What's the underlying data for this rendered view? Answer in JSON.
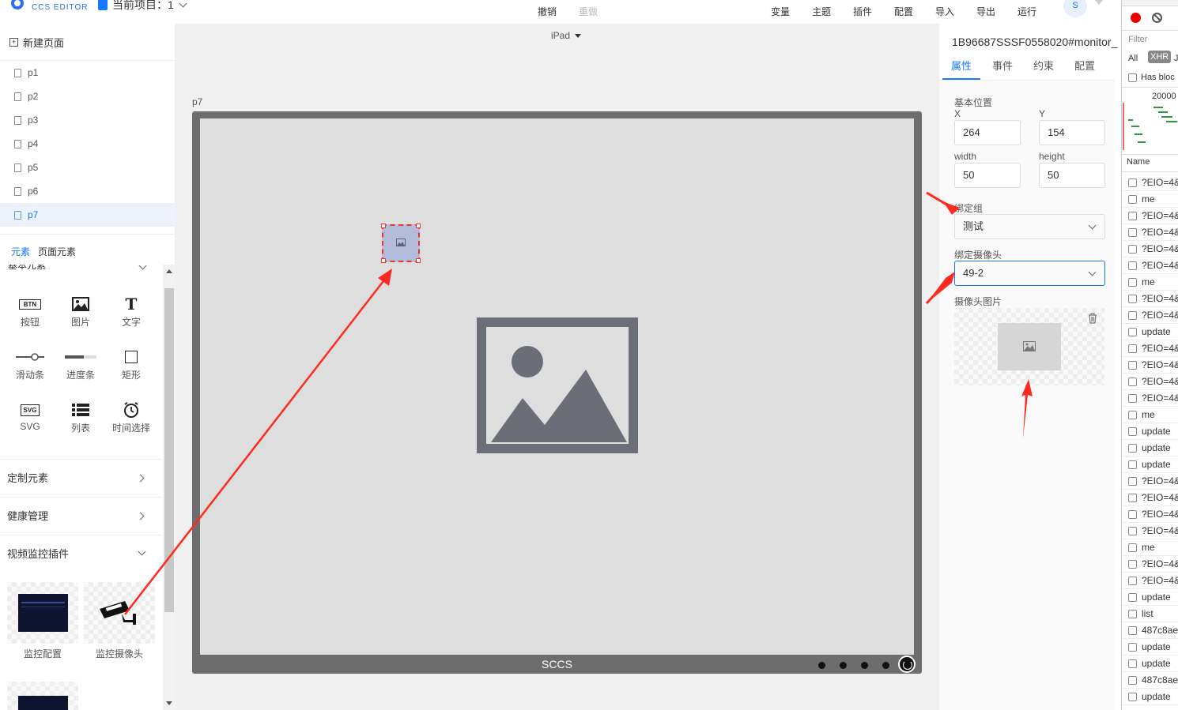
{
  "topbar": {
    "logo_text": "CCS EDITOR",
    "project_label": "当前项目：1",
    "undo": "撤销",
    "redo": "重做",
    "buttons": [
      "变量",
      "主题",
      "插件",
      "配置",
      "导入",
      "导出",
      "运行"
    ],
    "avatar": "S"
  },
  "sidebar": {
    "new_page": "新建页面",
    "pages": [
      "p1",
      "p2",
      "p3",
      "p4",
      "p5",
      "p6",
      "p7"
    ],
    "active_page": "p7",
    "tabs": [
      "元素",
      "页面元素"
    ],
    "basic_title": "基本元素",
    "tools": [
      {
        "label": "按钮",
        "icon": "btn-icon"
      },
      {
        "label": "图片",
        "icon": "image-icon"
      },
      {
        "label": "文字",
        "icon": "text-icon"
      },
      {
        "label": "滑动条",
        "icon": "slider-icon"
      },
      {
        "label": "进度条",
        "icon": "progress-icon"
      },
      {
        "label": "矩形",
        "icon": "rect-icon"
      },
      {
        "label": "SVG",
        "icon": "svg-icon"
      },
      {
        "label": "列表",
        "icon": "list-icon"
      },
      {
        "label": "时间选择",
        "icon": "clock-icon"
      }
    ],
    "sections": [
      "定制元素",
      "健康管理",
      "视频监控插件"
    ],
    "plugins": [
      "监控配置",
      "监控摄像头"
    ]
  },
  "canvas": {
    "device": "iPad",
    "page_label": "p7",
    "footer": "SCCS"
  },
  "props": {
    "element_id": "1B96687SSSF0558020#monitor_",
    "tabs": [
      "属性",
      "事件",
      "约束",
      "配置"
    ],
    "section_position": "基本位置",
    "x_label": "X",
    "x": "264",
    "y_label": "Y",
    "y": "154",
    "width_label": "width",
    "width": "50",
    "height_label": "height",
    "height": "50",
    "group_label": "绑定组",
    "group": "测试",
    "camera_label": "绑定摄像头",
    "camera": "49-2",
    "image_label": "摄像头图片"
  },
  "devtools": {
    "filter": "Filter",
    "filter_all": "All",
    "filter_xhr": "XHR",
    "filter_js": "J",
    "has_blocked": "Has bloc",
    "timeline_tick": "20000",
    "name_header": "Name",
    "requests": [
      "?EIO=4&",
      "me",
      "?EIO=4&",
      "?EIO=4&",
      "?EIO=4&",
      "?EIO=4&",
      "me",
      "?EIO=4&",
      "?EIO=4&",
      "update",
      "?EIO=4&",
      "?EIO=4&",
      "?EIO=4&",
      "?EIO=4&",
      "me",
      "update",
      "update",
      "update",
      "?EIO=4&",
      "?EIO=4&",
      "?EIO=4&",
      "?EIO=4&",
      "me",
      "?EIO=4&",
      "?EIO=4&",
      "update",
      "list",
      "487c8ae",
      "update",
      "update",
      "487c8ae",
      "update"
    ]
  },
  "colors": {
    "accent": "#1677ff",
    "annotation": "#ff3b30",
    "selection": "#b4bcdc"
  }
}
